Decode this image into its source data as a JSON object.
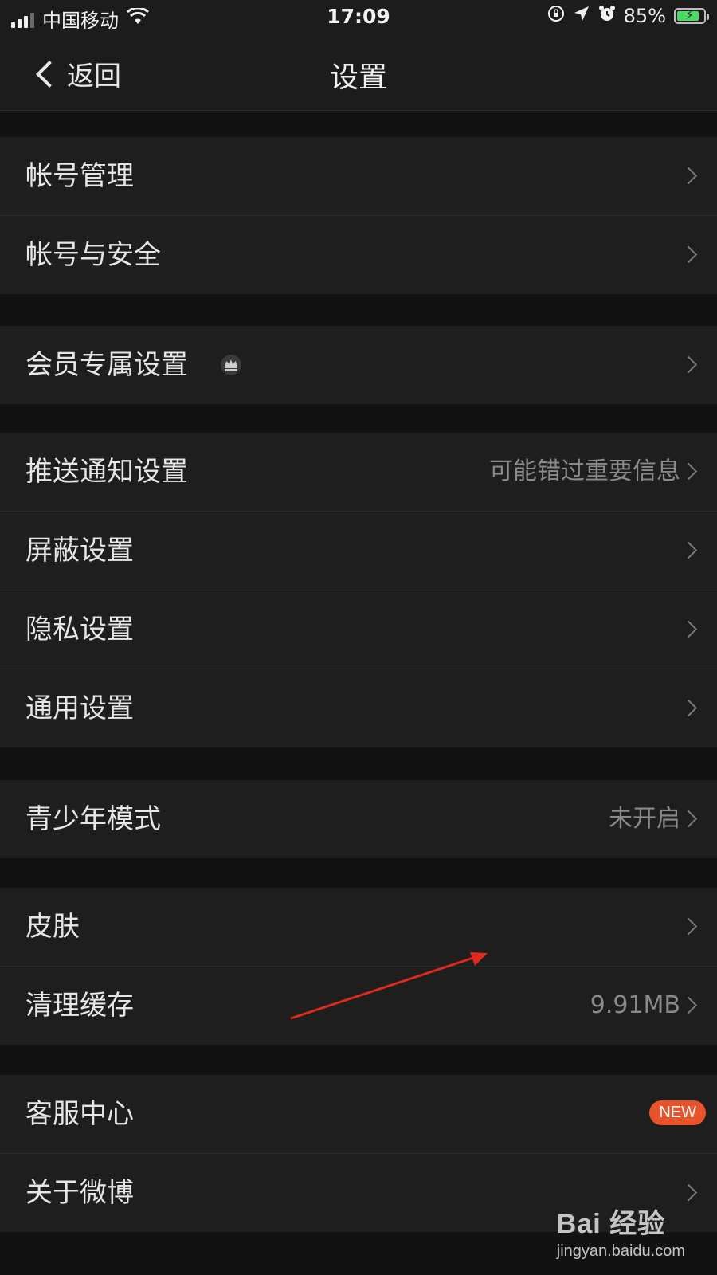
{
  "status_bar": {
    "carrier": "中国移动",
    "time": "17:09",
    "battery_percent": "85%",
    "battery_level": 0.85,
    "battery_color": "#4cd964"
  },
  "navbar": {
    "back_label": "返回",
    "title": "设置"
  },
  "groups": [
    {
      "items": [
        {
          "label": "帐号管理"
        },
        {
          "label": "帐号与安全"
        }
      ]
    },
    {
      "items": [
        {
          "label": "会员专属设置",
          "icon": "crown-icon"
        }
      ]
    },
    {
      "items": [
        {
          "label": "推送通知设置",
          "value": "可能错过重要信息"
        },
        {
          "label": "屏蔽设置"
        },
        {
          "label": "隐私设置"
        },
        {
          "label": "通用设置"
        }
      ]
    },
    {
      "items": [
        {
          "label": "青少年模式",
          "value": "未开启"
        }
      ]
    },
    {
      "items": [
        {
          "label": "皮肤"
        },
        {
          "label": "清理缓存",
          "value": "9.91MB"
        }
      ]
    },
    {
      "items": [
        {
          "label": "客服中心",
          "badge": "NEW"
        },
        {
          "label": "关于微博"
        }
      ]
    }
  ],
  "colors": {
    "background": "#121212",
    "cell": "#1e1e1e",
    "badge": "#e8532c",
    "annotation_arrow": "#e02a1e"
  },
  "watermark": {
    "main": "Bai 经验",
    "sub": "jingyan.baidu.com"
  }
}
